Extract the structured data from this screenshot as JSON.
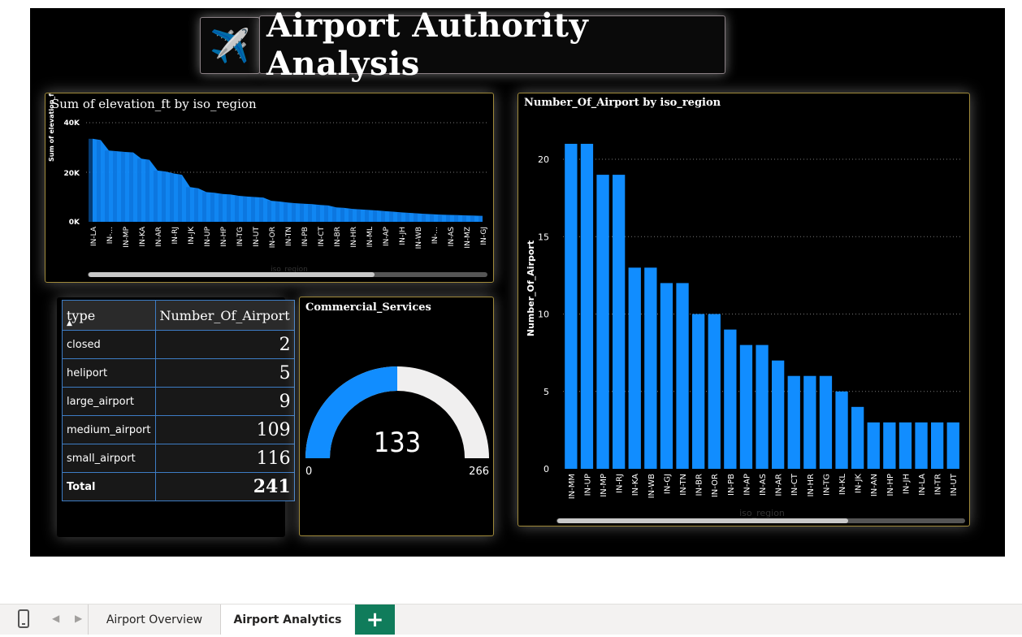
{
  "report": {
    "title": "Airport Authority Analysis",
    "icon": "airplane-icon",
    "icon_glyph": "✈️"
  },
  "elevation_chart": {
    "title": "Sum of elevation_ft by iso_region",
    "ylabel": "Sum of elevation_ft",
    "xlabel": "iso_region",
    "y_ticks": [
      "40K",
      "20K",
      "0K"
    ],
    "series_color": "#118dff"
  },
  "airport_chart": {
    "title": "Number_Of_Airport by iso_region",
    "ylabel": "Number_Of_Airport",
    "xlabel": "iso_region",
    "y_ticks": [
      "20",
      "15",
      "10",
      "5",
      "0"
    ],
    "series_color": "#118dff"
  },
  "type_table": {
    "headers": [
      "type",
      "Number_Of_Airport"
    ],
    "sort_indicator": "▲",
    "rows": [
      {
        "type": "closed",
        "count": "2"
      },
      {
        "type": "heliport",
        "count": "5"
      },
      {
        "type": "large_airport",
        "count": "9"
      },
      {
        "type": "medium_airport",
        "count": "109"
      },
      {
        "type": "small_airport",
        "count": "116"
      }
    ],
    "total_label": "Total",
    "total_value": "241"
  },
  "gauge": {
    "title": "Commercial_Services",
    "value": "133",
    "min": "0",
    "max": "266",
    "fill_color": "#118dff",
    "track_color": "#f0efef"
  },
  "tabs": {
    "device_icon": "phone-layout-icon",
    "prev_icon": "chevron-left-icon",
    "next_icon": "chevron-right-icon",
    "items": [
      "Airport Overview",
      "Airport Analytics"
    ],
    "active": "Airport Analytics",
    "add_label": "+"
  },
  "chart_data": [
    {
      "type": "area",
      "title": "Sum of elevation_ft by iso_region",
      "xlabel": "iso_region",
      "ylabel": "Sum of elevation_ft",
      "ylim": [
        0,
        40000
      ],
      "grid": true,
      "categories": [
        "IN-LA",
        "IN-...",
        "IN-MP",
        "IN-KA",
        "IN-AR",
        "IN-RJ",
        "IN-JK",
        "IN-UP",
        "IN-HP",
        "IN-TG",
        "IN-UT",
        "IN-OR",
        "IN-TN",
        "IN-PB",
        "IN-CT",
        "IN-BR",
        "IN-HR",
        "IN-ML",
        "IN-AP",
        "IN-JH",
        "IN-WB",
        "IN-...",
        "IN-AS",
        "IN-MZ",
        "IN-GJ"
      ],
      "x": [
        "IN-LA",
        "",
        "IN-...",
        "",
        "IN-MP",
        "",
        "IN-KA",
        "",
        "IN-AR",
        "",
        "IN-RJ",
        "",
        "IN-JK",
        "",
        "IN-UP",
        "",
        "IN-HP",
        "",
        "IN-TG",
        "",
        "IN-UT",
        "",
        "IN-OR",
        "",
        "IN-TN",
        "",
        "IN-PB",
        "",
        "IN-CT",
        "",
        "IN-BR",
        "",
        "IN-HR",
        "",
        "IN-ML",
        "",
        "IN-AP",
        "",
        "IN-JH",
        "",
        "IN-WB",
        "",
        "IN-...",
        "",
        "IN-AS",
        "",
        "IN-MZ",
        "",
        "IN-GJ"
      ],
      "values": [
        33500,
        33000,
        28800,
        28500,
        28200,
        28000,
        25500,
        25000,
        20700,
        20300,
        19500,
        19000,
        14000,
        13500,
        12000,
        11700,
        11200,
        11000,
        10500,
        10200,
        10000,
        9800,
        8500,
        8200,
        7800,
        7500,
        7300,
        7100,
        6800,
        6600,
        5800,
        5600,
        5200,
        5000,
        4800,
        4600,
        4300,
        4100,
        3800,
        3600,
        3400,
        3200,
        3000,
        2900,
        2800,
        2700,
        2600,
        2500,
        2400
      ]
    },
    {
      "type": "bar",
      "title": "Number_Of_Airport by iso_region",
      "xlabel": "iso_region",
      "ylabel": "Number_Of_Airport",
      "ylim": [
        0,
        22
      ],
      "grid": true,
      "categories": [
        "IN-MM",
        "IN-UP",
        "IN-MP",
        "IN-RJ",
        "IN-KA",
        "IN-WB",
        "IN-GJ",
        "IN-TN",
        "IN-BR",
        "IN-OR",
        "IN-PB",
        "IN-AP",
        "IN-AS",
        "IN-AR",
        "IN-CT",
        "IN-HR",
        "IN-TG",
        "IN-KL",
        "IN-JK",
        "IN-AN",
        "IN-HP",
        "IN-JH",
        "IN-LA",
        "IN-TR",
        "IN-UT"
      ],
      "values": [
        21,
        21,
        19,
        19,
        13,
        13,
        12,
        12,
        10,
        10,
        9,
        8,
        8,
        7,
        6,
        6,
        6,
        5,
        4,
        3,
        3,
        3,
        3,
        3,
        3
      ]
    }
  ]
}
